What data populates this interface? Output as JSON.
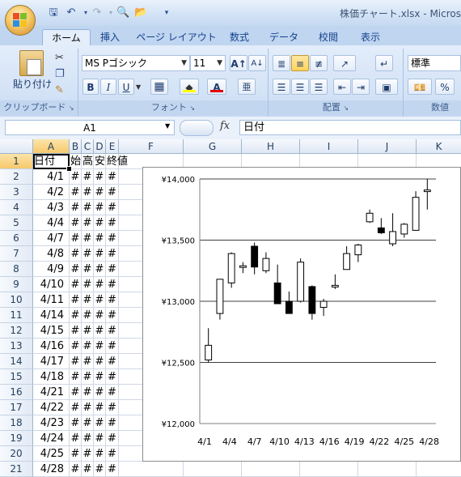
{
  "window": {
    "title": "株価チャート.xlsx - Microsoft",
    "qat_icons": [
      "save-icon",
      "undo-icon",
      "redo-icon",
      "print-preview-icon",
      "open-icon",
      "customize-icon"
    ]
  },
  "tabs": [
    "ホーム",
    "挿入",
    "ページ レイアウト",
    "数式",
    "データ",
    "校閲",
    "表示"
  ],
  "ribbon": {
    "clipboard": {
      "paste_label": "貼り付け",
      "group_label": "クリップボード"
    },
    "font": {
      "font_name": "MS Pゴシック",
      "font_size": "11",
      "group_label": "フォント",
      "bold": "B",
      "italic": "I",
      "underline": "U"
    },
    "alignment": {
      "group_label": "配置"
    },
    "number": {
      "format": "標準",
      "group_label": "数値",
      "percent": "%"
    }
  },
  "formula_bar": {
    "name_box": "A1",
    "fx": "fx",
    "content": "日付"
  },
  "grid": {
    "columns": [
      "A",
      "B",
      "C",
      "D",
      "E",
      "F",
      "G",
      "H",
      "I",
      "J",
      "K"
    ],
    "rows": [
      "1",
      "2",
      "3",
      "4",
      "5",
      "6",
      "7",
      "8",
      "9",
      "10",
      "11",
      "12",
      "13",
      "14",
      "15",
      "16",
      "17",
      "18",
      "19",
      "20",
      "21"
    ],
    "header_cells": [
      "日付",
      "始",
      "高",
      "安",
      "終値"
    ],
    "dates": [
      "4/1",
      "4/2",
      "4/3",
      "4/4",
      "4/7",
      "4/8",
      "4/9",
      "4/10",
      "4/11",
      "4/14",
      "4/15",
      "4/16",
      "4/17",
      "4/18",
      "4/21",
      "4/22",
      "4/23",
      "4/24",
      "4/25",
      "4/28"
    ],
    "hash": "#"
  },
  "chart_data": {
    "type": "candlestick",
    "categories": [
      "4/1",
      "4/2",
      "4/3",
      "4/4",
      "4/7",
      "4/8",
      "4/9",
      "4/10",
      "4/11",
      "4/14",
      "4/15",
      "4/16",
      "4/17",
      "4/18",
      "4/21",
      "4/22",
      "4/23",
      "4/24",
      "4/25",
      "4/28"
    ],
    "x_tick_labels": [
      "4/1",
      "4/4",
      "4/7",
      "4/10",
      "4/13",
      "4/16",
      "4/19",
      "4/22",
      "4/25",
      "4/28"
    ],
    "y_tick_labels": [
      "¥14,000",
      "¥13,500",
      "¥13,000",
      "¥12,500",
      "¥12,000"
    ],
    "ylim": [
      12000,
      14000
    ],
    "grid": true,
    "open": [
      12520,
      12900,
      13150,
      13280,
      13450,
      13250,
      13150,
      13000,
      13000,
      13120,
      12950,
      13120,
      13260,
      13380,
      13650,
      13600,
      13470,
      13550,
      13580,
      13900
    ],
    "high": [
      12780,
      13170,
      13400,
      13320,
      13480,
      13400,
      13300,
      13080,
      13350,
      13130,
      13020,
      13220,
      13450,
      13470,
      13750,
      13680,
      13720,
      13640,
      13900,
      14000
    ],
    "low": [
      12500,
      12850,
      13110,
      13230,
      13220,
      13230,
      12980,
      12900,
      12990,
      12850,
      12880,
      13100,
      13310,
      13320,
      13640,
      13550,
      13450,
      13520,
      13580,
      13750
    ],
    "close": [
      12640,
      13180,
      13390,
      13290,
      13280,
      13350,
      12980,
      12900,
      13320,
      12900,
      13000,
      13130,
      13390,
      13460,
      13720,
      13560,
      13570,
      13630,
      13850,
      13910
    ],
    "colors": {
      "up_fill": "#ffffff",
      "down_fill": "#000000",
      "stroke": "#000000",
      "grid": "#000000",
      "axis": "#808080"
    }
  }
}
